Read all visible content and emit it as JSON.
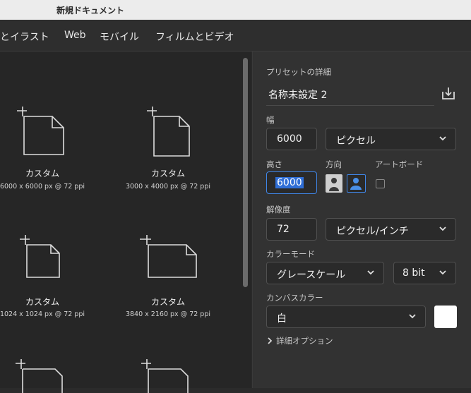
{
  "window": {
    "title": "新規ドキュメント"
  },
  "tabs": [
    {
      "label": "とイラスト"
    },
    {
      "label": "Web"
    },
    {
      "label": "モバイル"
    },
    {
      "label": "フィルムとビデオ"
    }
  ],
  "presets": [
    {
      "name": "カスタム",
      "size": "6000 x 6000 px @ 72 ppi"
    },
    {
      "name": "カスタム",
      "size": "3000 x 4000 px @ 72 ppi"
    },
    {
      "name": "カスタム",
      "size": "1024 x 1024 px @ 72 ppi"
    },
    {
      "name": "カスタム",
      "size": "3840 x 2160 px @ 72 ppi"
    }
  ],
  "details": {
    "section_title": "プリセットの詳細",
    "preset_name": "名称未設定 2",
    "width_label": "幅",
    "width_value": "6000",
    "unit": "ピクセル",
    "height_label": "高さ",
    "height_value": "6000",
    "orientation_label": "方向",
    "artboard_label": "アートボード",
    "resolution_label": "解像度",
    "resolution_value": "72",
    "resolution_unit": "ピクセル/インチ",
    "color_mode_label": "カラーモード",
    "color_mode": "グレースケール",
    "bit_depth": "8 bit",
    "canvas_color_label": "カンバスカラー",
    "canvas_color": "白",
    "advanced_options": "詳細オプション"
  },
  "colors": {
    "accent": "#2f6ed6",
    "canvas_swatch": "#ffffff"
  }
}
